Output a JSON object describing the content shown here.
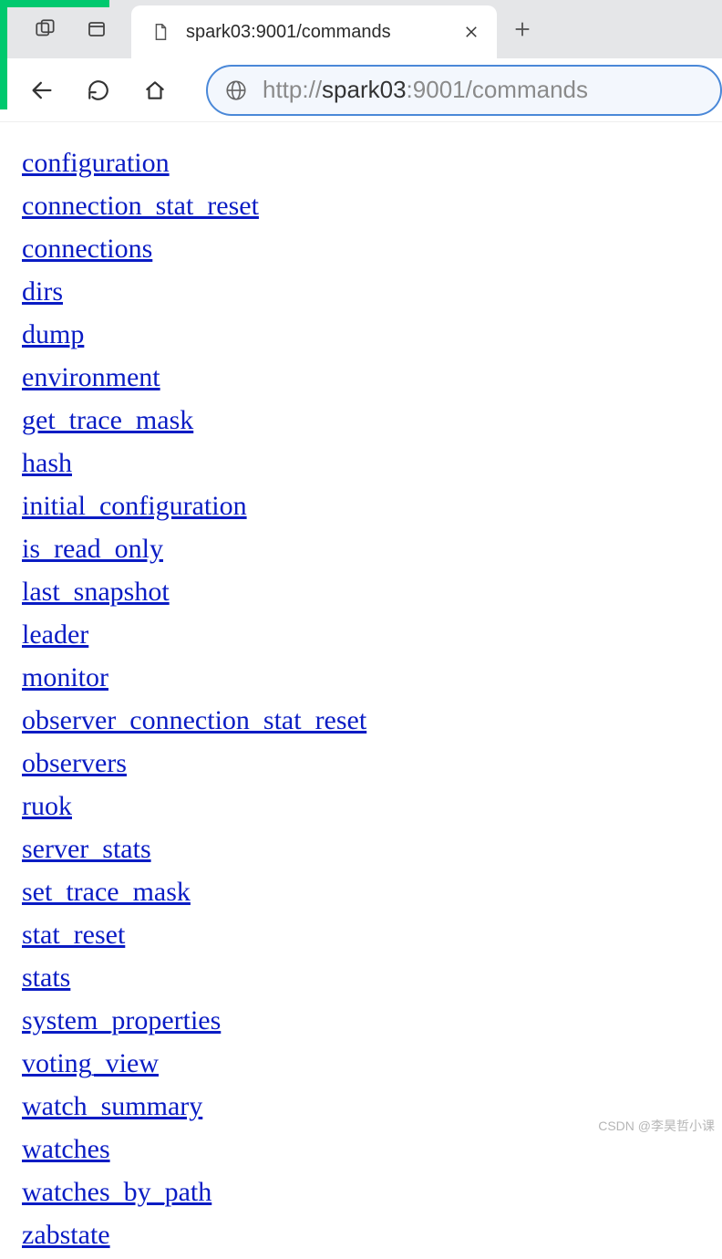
{
  "tab": {
    "title": "spark03:9001/commands"
  },
  "url": {
    "protocol": "http://",
    "host": "spark03",
    "rest": ":9001/commands"
  },
  "links": [
    "configuration",
    "connection_stat_reset",
    "connections",
    "dirs",
    "dump",
    "environment",
    "get_trace_mask",
    "hash",
    "initial_configuration",
    "is_read_only",
    "last_snapshot",
    "leader",
    "monitor",
    "observer_connection_stat_reset",
    "observers",
    "ruok",
    "server_stats",
    "set_trace_mask",
    "stat_reset",
    "stats",
    "system_properties",
    "voting_view",
    "watch_summary",
    "watches",
    "watches_by_path",
    "zabstate"
  ],
  "watermark": "CSDN @李昊哲小课"
}
